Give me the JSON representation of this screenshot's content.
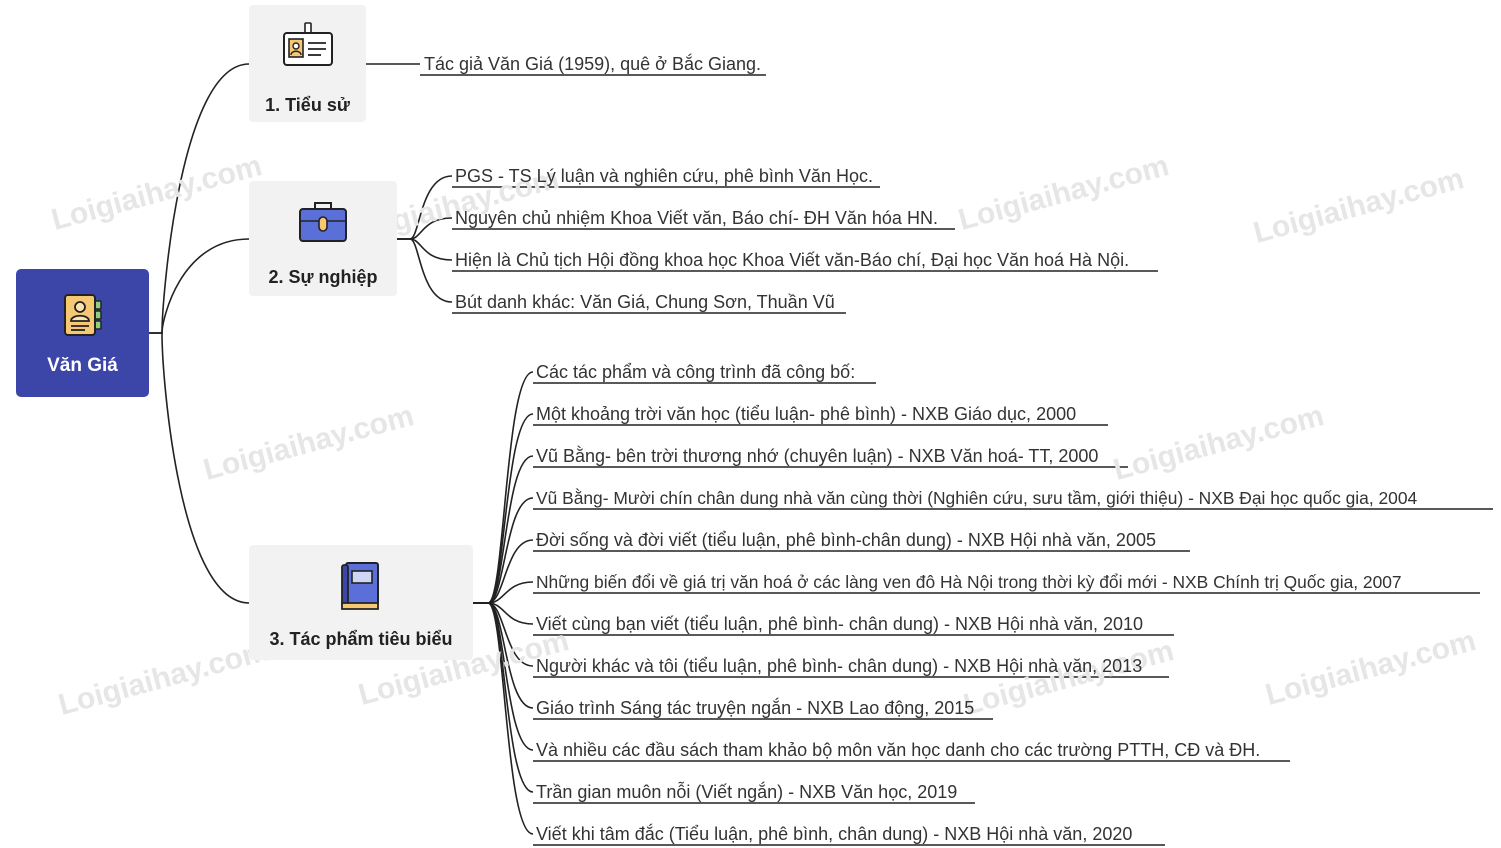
{
  "root": {
    "label": "Văn Giá",
    "icon": "contact-card-icon"
  },
  "branches": [
    {
      "label": "1. Tiểu sử",
      "icon": "id-badge-icon",
      "items": [
        "Tác giả Văn Giá (1959), quê ở Bắc Giang."
      ]
    },
    {
      "label": "2. Sự nghiệp",
      "icon": "briefcase-icon",
      "items": [
        "PGS - TS Lý luận và nghiên cứu, phê bình Văn Học.",
        "Nguyên chủ nhiệm Khoa Viết văn, Báo chí- ĐH Văn hóa HN.",
        "Hiện là Chủ tịch Hội đồng khoa học Khoa Viết văn-Báo chí, Đại học Văn hoá Hà Nội.",
        "Bút danh khác: Văn Giá, Chung Sơn, Thuần Vũ"
      ]
    },
    {
      "label": "3. Tác phẩm tiêu biểu",
      "icon": "book-icon",
      "items": [
        "Các tác phẩm và công trình đã công bố:",
        "Một khoảng trời văn học (tiểu luận- phê bình) - NXB Giáo dục, 2000",
        "Vũ Bằng- bên trời thương nhớ (chuyên luận) - NXB Văn hoá- TT, 2000",
        "Vũ Bằng- Mười chín chân dung nhà văn cùng thời (Nghiên cứu, sưu tầm, giới thiệu) - NXB Đại học quốc gia, 2004",
        "Đời sống và đời viết (tiểu luận, phê bình-chân dung) - NXB Hội nhà văn, 2005",
        "Những biến đổi về giá trị văn hoá ở các làng ven đô Hà Nội trong thời kỳ đổi mới - NXB Chính trị Quốc gia, 2007",
        "Viết cùng bạn viết (tiểu luận, phê bình- chân dung) - NXB Hội nhà văn, 2010",
        "Người khác và tôi (tiểu luận, phê bình- chân dung) - NXB Hội nhà văn, 2013",
        "Giáo trình Sáng tác truyện ngắn - NXB Lao động, 2015",
        "Và nhiều các đầu sách tham khảo bộ môn văn học danh cho các trường PTTH, CĐ và ĐH.",
        "Trần gian muôn nỗi (Viết ngắn) - NXB Văn học, 2019",
        "Viết khi tâm đắc (Tiểu luận, phê bình, chân dung) - NXB Hội nhà văn, 2020"
      ]
    }
  ],
  "watermark": "Loigiaihay.com",
  "colors": {
    "root_fill": "#3b46a8",
    "branch_fill": "#f2f2f2",
    "line": "#222222"
  }
}
